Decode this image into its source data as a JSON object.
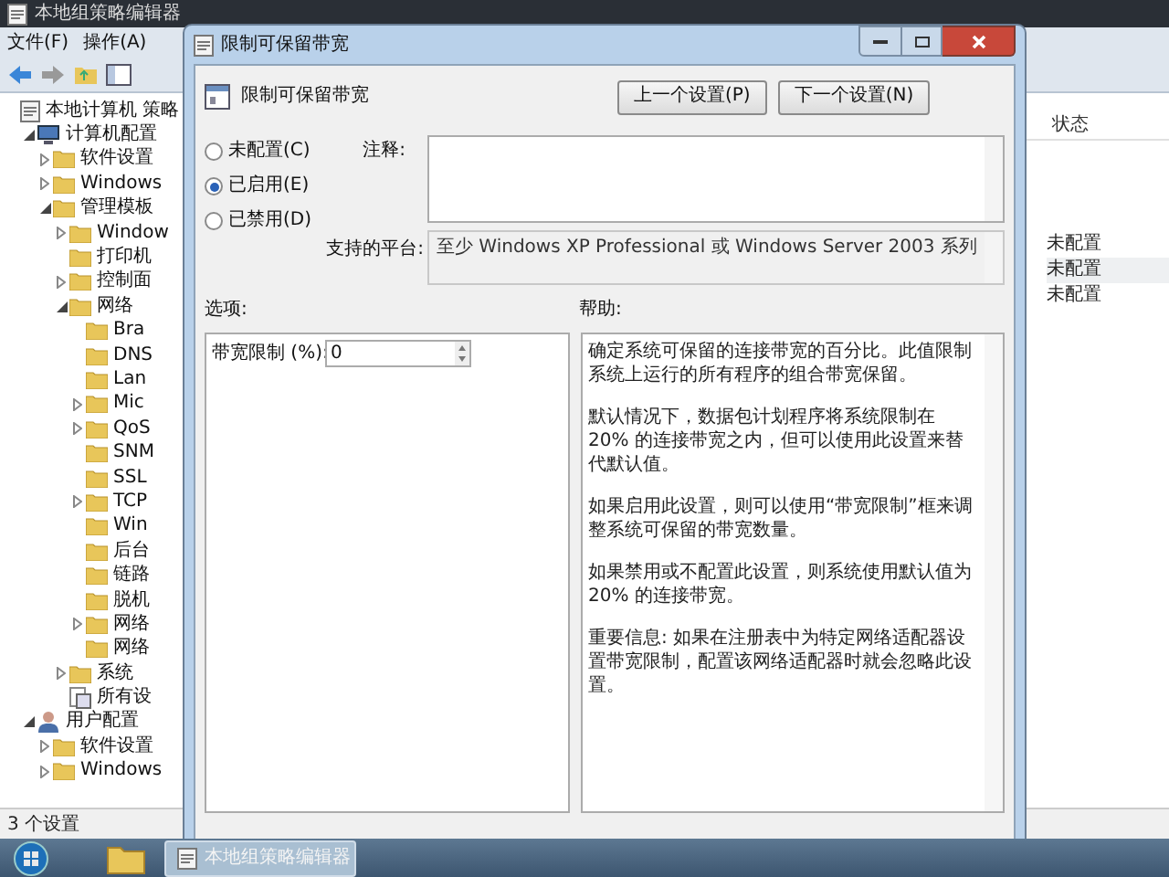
{
  "editor": {
    "title": "本地组策略编辑器",
    "menu": [
      "文件(F)",
      "操作(A)"
    ],
    "tree": [
      {
        "label": "本地计算机 策略",
        "kind": "policy",
        "children": [
          {
            "label": "计算机配置",
            "kind": "computer",
            "expanded": true,
            "children": [
              {
                "label": "软件设置",
                "kind": "folder",
                "expanded": false
              },
              {
                "label": "Windows",
                "kind": "folder",
                "expanded": false
              },
              {
                "label": "管理模板",
                "kind": "folder",
                "expanded": true,
                "children": [
                  {
                    "label": "Window",
                    "kind": "folder",
                    "expanded": false
                  },
                  {
                    "label": "打印机",
                    "kind": "folder"
                  },
                  {
                    "label": "控制面",
                    "kind": "folder",
                    "expanded": false
                  },
                  {
                    "label": "网络",
                    "kind": "folder",
                    "expanded": true,
                    "children": [
                      {
                        "label": "Bra",
                        "kind": "folder"
                      },
                      {
                        "label": "DNS",
                        "kind": "folder"
                      },
                      {
                        "label": "Lan",
                        "kind": "folder"
                      },
                      {
                        "label": "Mic",
                        "kind": "folder",
                        "expanded": false
                      },
                      {
                        "label": "QoS",
                        "kind": "folder",
                        "expanded": false
                      },
                      {
                        "label": "SNM",
                        "kind": "folder"
                      },
                      {
                        "label": "SSL",
                        "kind": "folder"
                      },
                      {
                        "label": "TCP",
                        "kind": "folder",
                        "expanded": false
                      },
                      {
                        "label": "Win",
                        "kind": "folder"
                      },
                      {
                        "label": "后台",
                        "kind": "folder"
                      },
                      {
                        "label": "链路",
                        "kind": "folder"
                      },
                      {
                        "label": "脱机",
                        "kind": "folder"
                      },
                      {
                        "label": "网络",
                        "kind": "folder",
                        "expanded": false
                      },
                      {
                        "label": "网络",
                        "kind": "folder"
                      }
                    ]
                  },
                  {
                    "label": "系统",
                    "kind": "folder",
                    "expanded": false
                  },
                  {
                    "label": "所有设",
                    "kind": "settings"
                  }
                ]
              }
            ]
          },
          {
            "label": "用户配置",
            "kind": "user",
            "expanded": true,
            "children": [
              {
                "label": "软件设置",
                "kind": "folder",
                "expanded": false
              },
              {
                "label": "Windows",
                "kind": "folder",
                "expanded": false
              }
            ]
          }
        ]
      }
    ],
    "list": {
      "columns": [
        "状态"
      ],
      "rows": [
        "未配置",
        "未配置",
        "未配置"
      ]
    },
    "status_bar": "3 个设置"
  },
  "dialog": {
    "title": "限制可保留带宽",
    "heading": "限制可保留带宽",
    "nav_buttons": [
      "上一个设置(P)",
      "下一个设置(N)"
    ],
    "radios": [
      {
        "label": "未配置(C)",
        "selected": false
      },
      {
        "label": "已启用(E)",
        "selected": true
      },
      {
        "label": "已禁用(D)",
        "selected": false
      }
    ],
    "comment_label": "注释:",
    "platform_label": "支持的平台:",
    "platform": "至少 Windows XP Professional 或 Windows Server 2003 系列",
    "options_label": "选项:",
    "help_label": "帮助:",
    "option": {
      "label": "带宽限制 (%):",
      "value": "0"
    },
    "help": [
      "确定系统可保留的连接带宽的百分比。此值限制系统上运行的所有程序的组合带宽保留。",
      "默认情况下，数据包计划程序将系统限制在 20% 的连接带宽之内，但可以使用此设置来替代默认值。",
      "如果启用此设置，则可以使用“带宽限制”框来调整系统可保留的带宽数量。",
      "如果禁用或不配置此设置，则系统使用默认值为 20% 的连接带宽。",
      "重要信息: 如果在注册表中为特定网络适配器设置带宽限制，配置该网络适配器时就会忽略此设置。"
    ]
  },
  "taskbar": {
    "task": "本地组策略编辑器"
  }
}
